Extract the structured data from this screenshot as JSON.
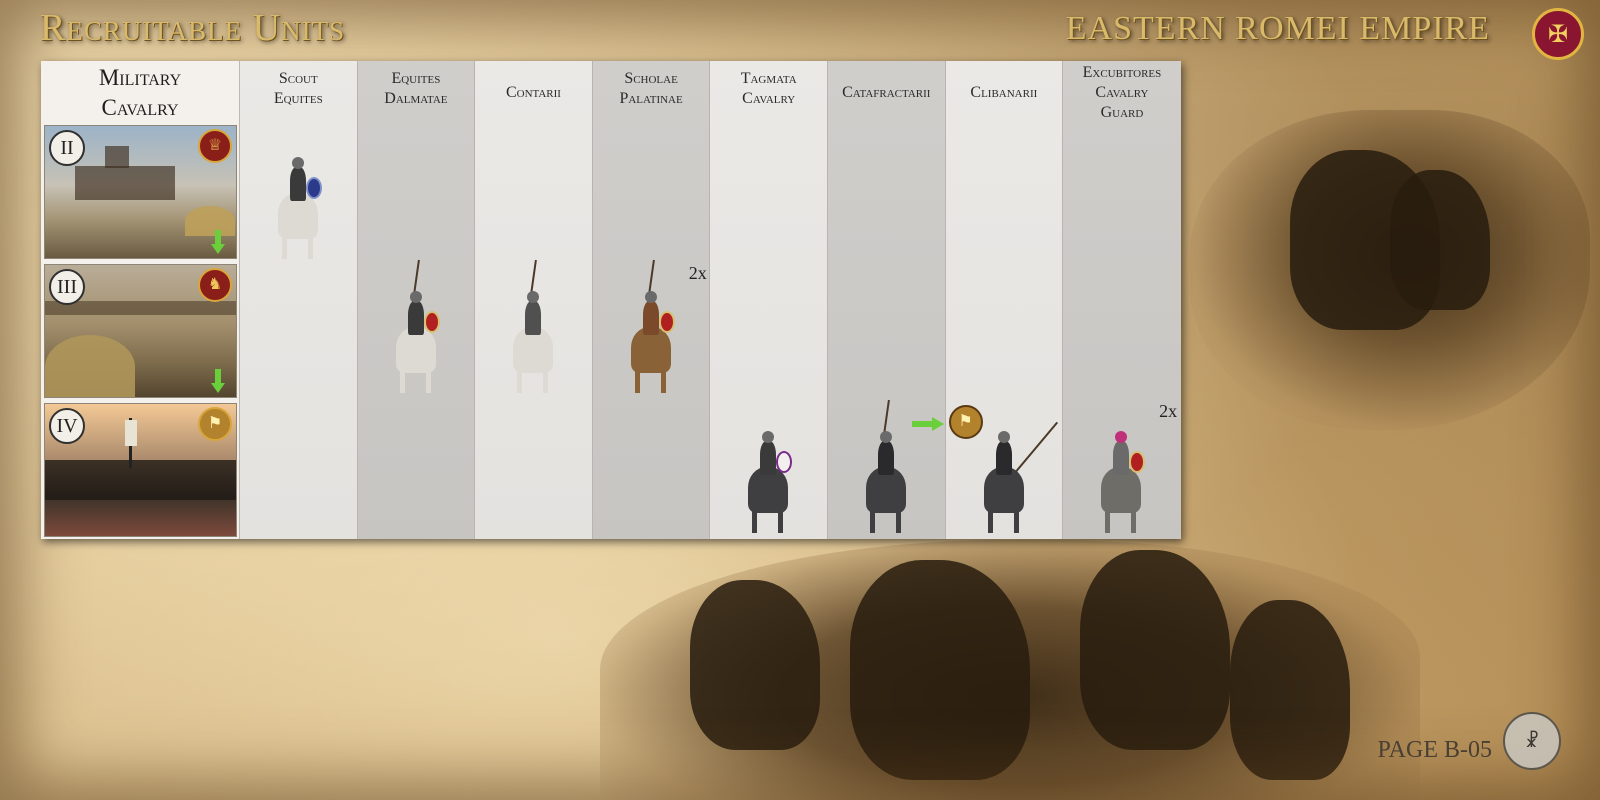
{
  "header": {
    "title": "Recruitable Units",
    "faction": "EASTERN ROMEI EMPIRE",
    "faction_emblem_icon": "double-eagle-emblem-icon"
  },
  "table": {
    "category_label_line1": "Military",
    "category_label_line2": "Cavalry",
    "tiers": [
      {
        "numeral": "II",
        "badge_icon": "helmet-icon",
        "has_upgrade_arrow": true
      },
      {
        "numeral": "III",
        "badge_icon": "horse-head-icon",
        "has_upgrade_arrow": true
      },
      {
        "numeral": "IV",
        "badge_icon": "standard-icon",
        "has_upgrade_arrow": false
      }
    ],
    "units": [
      {
        "line1": "Scout",
        "line2": "Equites",
        "line3": "",
        "tier": "II",
        "multiplier": ""
      },
      {
        "line1": "Equites",
        "line2": "Dalmatae",
        "line3": "",
        "tier": "III",
        "multiplier": ""
      },
      {
        "line1": "Contarii",
        "line2": "",
        "line3": "",
        "tier": "III",
        "multiplier": ""
      },
      {
        "line1": "Scholae",
        "line2": "Palatinae",
        "line3": "",
        "tier": "III",
        "multiplier": "2x"
      },
      {
        "line1": "Tagmata",
        "line2": "Cavalry",
        "line3": "",
        "tier": "IV",
        "multiplier": ""
      },
      {
        "line1": "Catafractarii",
        "line2": "",
        "line3": "",
        "tier": "IV",
        "multiplier": ""
      },
      {
        "line1": "Clibanarii",
        "line2": "",
        "line3": "",
        "tier": "IV",
        "multiplier": ""
      },
      {
        "line1": "Excubitores",
        "line2": "Cavalry",
        "line3": "Guard",
        "tier": "IV",
        "multiplier": "2x"
      }
    ],
    "upgrade_badge_icon": "standard-icon"
  },
  "footer": {
    "page": "PAGE B-05",
    "logo_icon": "mod-logo-icon"
  }
}
